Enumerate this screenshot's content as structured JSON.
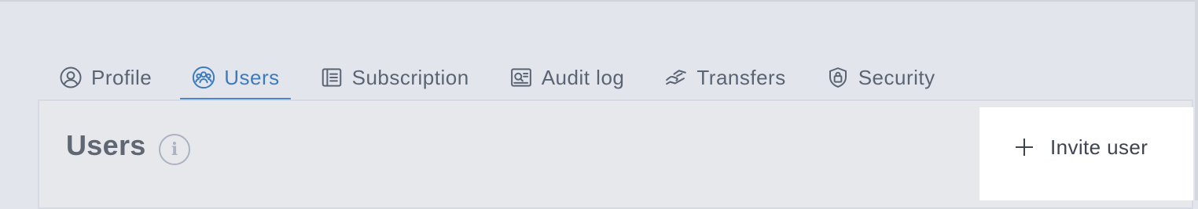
{
  "tabs": [
    {
      "label": "Profile",
      "icon": "user-circle-icon",
      "active": false
    },
    {
      "label": "Users",
      "icon": "users-group-icon",
      "active": true
    },
    {
      "label": "Subscription",
      "icon": "subscription-list-icon",
      "active": false
    },
    {
      "label": "Audit log",
      "icon": "audit-log-icon",
      "active": false
    },
    {
      "label": "Transfers",
      "icon": "transfers-icon",
      "active": false
    },
    {
      "label": "Security",
      "icon": "shield-lock-icon",
      "active": false
    }
  ],
  "panel": {
    "title": "Users",
    "info_glyph": "i"
  },
  "invite": {
    "label": "Invite user",
    "icon": "plus-icon"
  },
  "colors": {
    "background": "#e2e5ec",
    "active_tab": "#3d7bbf",
    "tab_text": "#5b6473",
    "panel_bg": "#e7e8ec",
    "invite_bg": "#ffffff"
  }
}
